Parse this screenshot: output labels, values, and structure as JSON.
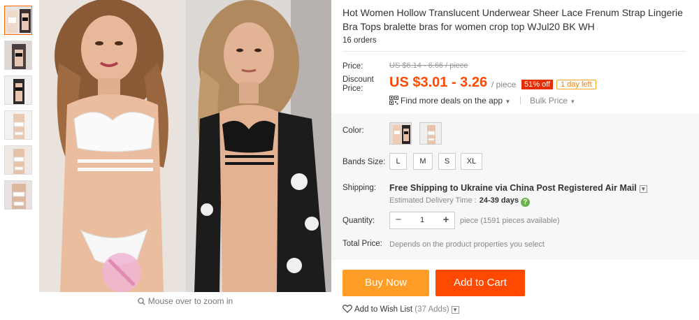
{
  "gallery": {
    "zoom_hint": "Mouse over to zoom in",
    "thumbnails": [
      "thumb-1",
      "thumb-2",
      "thumb-3",
      "thumb-4",
      "thumb-5",
      "thumb-6"
    ]
  },
  "product": {
    "title": "Hot Women Hollow Translucent Underwear Sheer Lace Frenum Strap Lingerie Bra Tops bralette bras for women crop top WJul20 BK WH",
    "orders": "16 orders"
  },
  "price": {
    "label": "Price:",
    "original": "US $6.14 - 6.66 / piece",
    "discount_label_1": "Discount",
    "discount_label_2": "Price:",
    "discount": "US $3.01 - 3.26",
    "per": "/ piece",
    "off_badge": "51% off",
    "time_left": "1 day left",
    "deals_link": "Find more deals on the app",
    "bulk_price": "Bulk Price"
  },
  "sku": {
    "color_label": "Color:",
    "size_label": "Bands Size:",
    "sizes": [
      "L",
      "M",
      "S",
      "XL"
    ]
  },
  "shipping": {
    "label": "Shipping:",
    "method": "Free Shipping to Ukraine via China Post Registered Air Mail",
    "est_label": "Estimated Delivery Time :",
    "est_value": "24-39 days"
  },
  "quantity": {
    "label": "Quantity:",
    "value": "1",
    "minus": "−",
    "plus": "+",
    "note": "piece (1591 pieces available)"
  },
  "total": {
    "label": "Total Price:",
    "note": "Depends on the product properties you select"
  },
  "actions": {
    "buy_now": "Buy Now",
    "add_to_cart": "Add to Cart",
    "wishlist": "Add to Wish List",
    "wishlist_count": "(37 Adds)"
  },
  "colors": {
    "accent": "#ff4800",
    "buy_now": "#ff9d26",
    "badge": "#e62e04"
  }
}
